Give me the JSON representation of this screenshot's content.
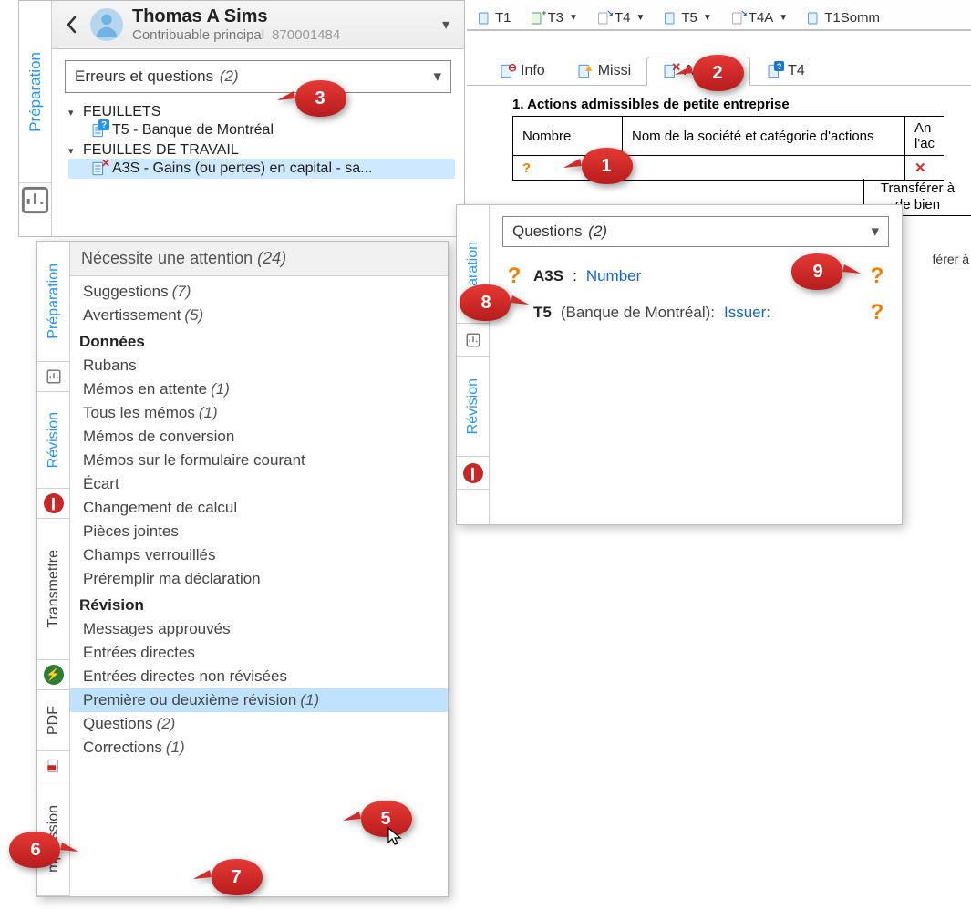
{
  "profile": {
    "name": "Thomas A Sims",
    "role": "Contribuable principal",
    "sin": "870001484"
  },
  "left_vtab": "Préparation",
  "left_combo": {
    "label": "Erreurs et questions",
    "count": "(2)"
  },
  "tree": {
    "group1": "FEUILLETS",
    "item1": "T5 - Banque de Montréal",
    "group2": "FEUILLES DE TRAVAIL",
    "item2": "A3S - Gains (ou pertes) en capital  - sa..."
  },
  "menu": {
    "header_label": "Nécessite une attention",
    "header_count": "(24)",
    "vtabs": {
      "prep": "Préparation",
      "rev": "Révision",
      "trans": "Transmettre",
      "pdf": "PDF",
      "imp": "mpression"
    },
    "items": [
      {
        "text": "Suggestions",
        "count": "(7)",
        "kind": "item"
      },
      {
        "text": "Avertissement",
        "count": "(5)",
        "kind": "item"
      },
      {
        "text": "Données",
        "kind": "section"
      },
      {
        "text": "Rubans",
        "kind": "item"
      },
      {
        "text": "Mémos en attente",
        "count": "(1)",
        "kind": "item"
      },
      {
        "text": "Tous les mémos",
        "count": "(1)",
        "kind": "item"
      },
      {
        "text": "Mémos de conversion",
        "kind": "item"
      },
      {
        "text": "Mémos sur le formulaire courant",
        "kind": "item"
      },
      {
        "text": "Écart",
        "kind": "item"
      },
      {
        "text": "Changement de calcul",
        "kind": "item"
      },
      {
        "text": "Pièces jointes",
        "kind": "item"
      },
      {
        "text": "Champs verrouillés",
        "kind": "item"
      },
      {
        "text": "Préremplir ma déclaration",
        "kind": "item"
      },
      {
        "text": "Révision",
        "kind": "section"
      },
      {
        "text": "Messages approuvés",
        "kind": "item"
      },
      {
        "text": "Entrées directes",
        "kind": "item"
      },
      {
        "text": "Entrées directes non révisées",
        "kind": "item"
      },
      {
        "text": "Première ou deuxième révision",
        "count": "(1)",
        "kind": "item",
        "selected": true
      },
      {
        "text": "Questions",
        "count": "(2)",
        "kind": "item"
      },
      {
        "text": "Corrections",
        "count": "(1)",
        "kind": "item"
      }
    ]
  },
  "form_tabs": [
    "T1",
    "T3",
    "T4",
    "T5",
    "T4A",
    "T1Somm"
  ],
  "sec_tabs": {
    "info": "Info",
    "missi": "Missi",
    "a3s": "A3S",
    "t4": "T4"
  },
  "form": {
    "title": "1. Actions admissibles de petite entreprise",
    "h1": "Nombre",
    "h2": "Nom de la société et catégorie d'actions",
    "h3": "An",
    "h3b": "l'ac",
    "transfer1": "Transférer à",
    "transfer2": "de bien",
    "ferer": "férer à"
  },
  "qpanel": {
    "vtab_a": "aration",
    "vtab_b": "Révision",
    "combo_label": "Questions",
    "combo_count": "(2)",
    "row1_code": "A3S",
    "row1_label": "Number",
    "row2_code": "T5",
    "row2_paren": "(Banque de Montréal):",
    "row2_label": "Issuer:"
  },
  "callouts": {
    "1": "1",
    "2": "2",
    "3": "3",
    "5": "5",
    "6": "6",
    "7": "7",
    "8": "8",
    "9": "9"
  }
}
